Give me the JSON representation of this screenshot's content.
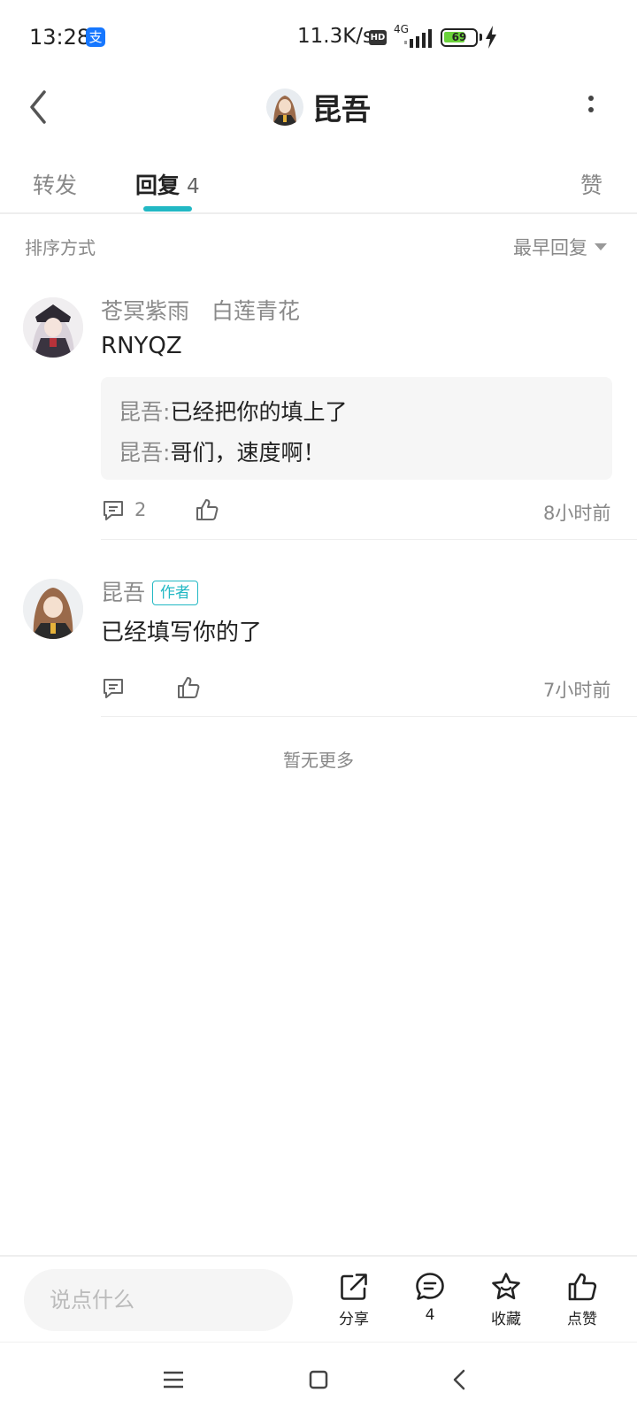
{
  "status_bar": {
    "time": "13:28",
    "alipay_glyph": "支",
    "net_speed": "11.3K/s",
    "hd_badge": "HD",
    "network_type": "4G",
    "battery_level": "69",
    "battery_fraction": 0.69,
    "battery_color": "#6ad23a"
  },
  "header": {
    "title": "昆吾",
    "back_icon": "chevron-left-icon",
    "more_icon": "vertical-dots-icon"
  },
  "tabs": {
    "repost": "转发",
    "reply": "回复",
    "reply_count": "4",
    "like": "赞",
    "accent_color": "#22b8c4"
  },
  "sort": {
    "label": "排序方式",
    "value": "最早回复"
  },
  "comments": [
    {
      "user": "苍冥紫雨　白莲青花",
      "text": "RNYQZ",
      "replies": [
        {
          "user": "昆吾",
          "sep": ":",
          "text": "已经把你的填上了"
        },
        {
          "user": "昆吾",
          "sep": ":",
          "text": "哥们，速度啊！"
        }
      ],
      "reply_count": "2",
      "time": "8小时前"
    },
    {
      "user": "昆吾",
      "badge": "作者",
      "text": "已经填写你的了",
      "time": "7小时前"
    }
  ],
  "no_more": "暂无更多",
  "bottom_bar": {
    "input_placeholder": "说点什么",
    "share_label": "分享",
    "comment_count": "4",
    "favorite_label": "收藏",
    "like_label": "点赞"
  }
}
